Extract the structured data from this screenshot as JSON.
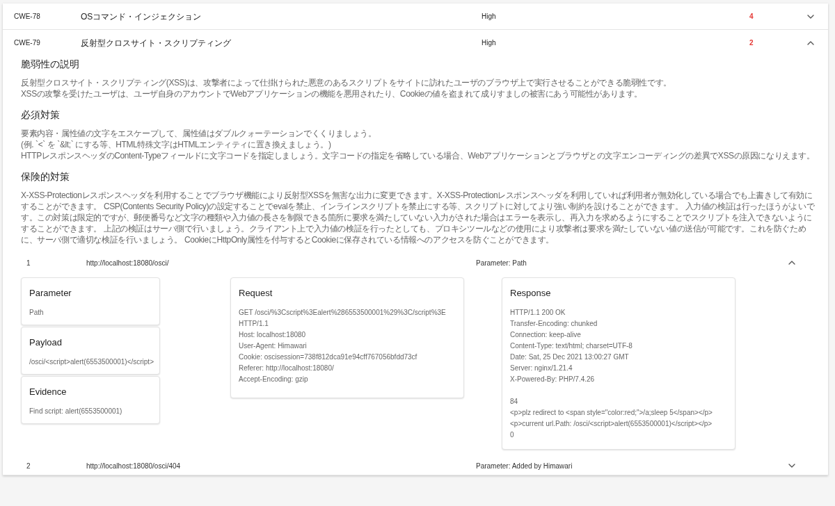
{
  "vulnerabilities": [
    {
      "id": "CWE-78",
      "name": "OSコマンド・インジェクション",
      "severity": "High",
      "count": "4",
      "expanded": false
    },
    {
      "id": "CWE-79",
      "name": "反射型クロスサイト・スクリプティング",
      "severity": "High",
      "count": "2",
      "expanded": true,
      "sections": [
        {
          "title": "脆弱性の説明",
          "lines": [
            "反射型クロスサイト・スクリプティング(XSS)は、攻撃者によって仕掛けられた悪意のあるスクリプトをサイトに訪れたユーザのブラウザ上で実行させることができる脆弱性です。",
            "XSSの攻撃を受けたユーザは、ユーザ自身のアカウントでWebアプリケーションの機能を悪用されたり、Cookieの値を盗まれて成りすましの被害にあう可能性があります。"
          ]
        },
        {
          "title": "必須対策",
          "lines": [
            "要素内容・属性値の文字をエスケープして、属性値はダブルクォーテーションでくくりましょう。",
            "(例. `<` を `&lt;` にする等、HTML特殊文字はHTMLエンティティに置き換えましょう。)",
            "HTTPレスポンスヘッダのContent-Typeフィールドに文字コードを指定しましょう。文字コードの指定を省略している場合、Webアプリケーションとブラウザとの文字エンコーディングの差異でXSSの原因になりえます。"
          ]
        },
        {
          "title": "保険的対策",
          "lines": [
            "X-XSS-Protectionレスポンスヘッダを利用することでブラウザ機能により反射型XSSを無害な出力に変更できます。X-XSS-Protectionレスポンスヘッダを利用していれば利用者が無効化している場合でも上書きして有効にすることができます。 CSP(Contents Security Policy)の設定することでevalを禁止、インラインスクリプトを禁止にする等、スクリプトに対してより強い制約を設けることができます。 入力値の検証は行ったほうがよいです。この対策は限定的ですが、郵便番号など文字の種類や入力値の長さを制限できる箇所に要求を満たしていない入力がされた場合はエラーを表示し、再入力を求めるようにすることでスクリプトを注入できないようにすることができます。 上記の検証はサーバ側で行いましょう。クライアント上で入力値の検証を行ったとしても、プロキシツールなどの使用により攻撃者は要求を満たしていない値の送信が可能です。これを防ぐために、サーバ側で適切な検証を行いましょう。 CookieにHttpOnly属性を付与するとCookieに保存されている情報へのアクセスを防ぐことができます。"
          ]
        }
      ],
      "instances": [
        {
          "number": "1",
          "url": "http://localhost:18080/osci/",
          "parameter": "Parameter: Path",
          "expanded": true,
          "info_cards": [
            {
              "title": "Parameter",
              "text": "Path"
            },
            {
              "title": "Payload",
              "text": "/osci/<script>alert(6553500001)</script>"
            },
            {
              "title": "Evidence",
              "text": "Find script: alert(6553500001)"
            }
          ],
          "request": {
            "title": "Request",
            "blocks": [
              [
                "GET /osci/%3Cscript%3Ealert%286553500001%29%3C/script%3E HTTP/1.1",
                "Host: localhost:18080",
                "User-Agent: Himawari",
                "Cookie: oscisession=738f812dca91e94cff767056bfdd73cf",
                "Referer: http://localhost:18080/",
                "Accept-Encoding: gzip"
              ]
            ]
          },
          "response": {
            "title": "Response",
            "blocks": [
              [
                "HTTP/1.1 200 OK",
                "Transfer-Encoding: chunked",
                "Connection: keep-alive",
                "Content-Type: text/html; charset=UTF-8",
                "Date: Sat, 25 Dec 2021 13:00:27 GMT",
                "Server: nginx/1.21.4",
                "X-Powered-By: PHP/7.4.26"
              ],
              [
                "84",
                "<p>plz redirect to <span style=\"color:red;\">/a;sleep 5</span></p>",
                "<p>current url.Path: /osci/<script>alert(6553500001)</script></p>",
                "0"
              ]
            ]
          }
        },
        {
          "number": "2",
          "url": "http://localhost:18080/osci/404",
          "parameter": "Parameter: Added by Himawari",
          "expanded": false
        }
      ]
    }
  ]
}
